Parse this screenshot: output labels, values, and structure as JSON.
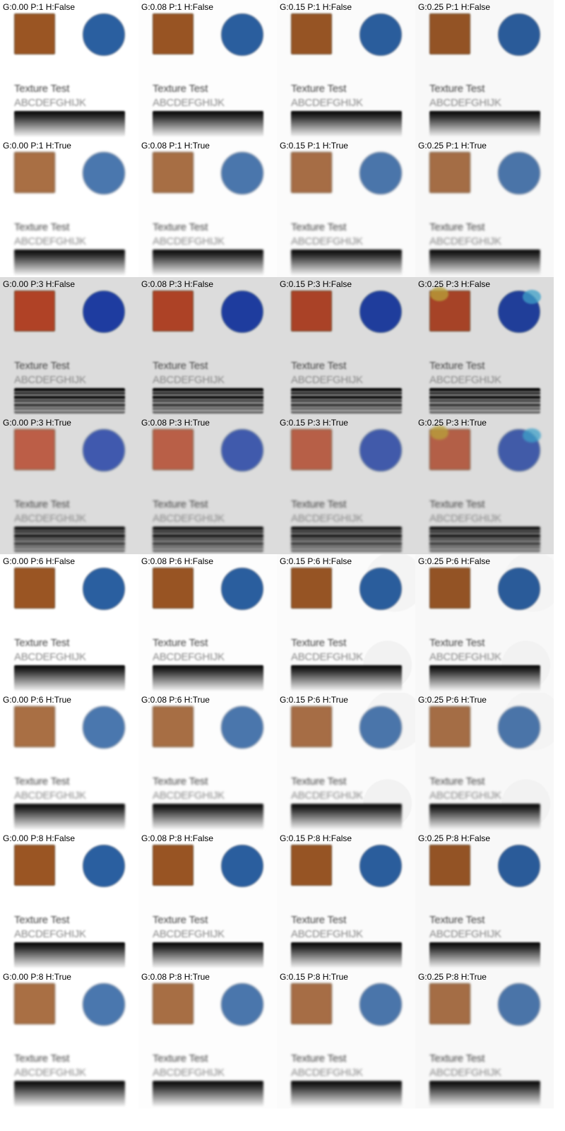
{
  "sample": {
    "title_text": "Texture Test",
    "alphabet_text": "ABCDEFGHIJK"
  },
  "colors": {
    "square_base": "#9a5523",
    "circle_base": "#2a5fa0"
  },
  "tiles": [
    {
      "label": "G:0.00 P:1 H:False",
      "g": 0.0,
      "p": 1,
      "h": false
    },
    {
      "label": "G:0.08 P:1 H:False",
      "g": 0.08,
      "p": 1,
      "h": false
    },
    {
      "label": "G:0.15 P:1 H:False",
      "g": 0.15,
      "p": 1,
      "h": false
    },
    {
      "label": "G:0.25 P:1 H:False",
      "g": 0.25,
      "p": 1,
      "h": false
    },
    {
      "label": "G:0.00 P:1 H:True",
      "g": 0.0,
      "p": 1,
      "h": true
    },
    {
      "label": "G:0.08 P:1 H:True",
      "g": 0.08,
      "p": 1,
      "h": true
    },
    {
      "label": "G:0.15 P:1 H:True",
      "g": 0.15,
      "p": 1,
      "h": true
    },
    {
      "label": "G:0.25 P:1 H:True",
      "g": 0.25,
      "p": 1,
      "h": true
    },
    {
      "label": "G:0.00 P:3 H:False",
      "g": 0.0,
      "p": 3,
      "h": false
    },
    {
      "label": "G:0.08 P:3 H:False",
      "g": 0.08,
      "p": 3,
      "h": false
    },
    {
      "label": "G:0.15 P:3 H:False",
      "g": 0.15,
      "p": 3,
      "h": false
    },
    {
      "label": "G:0.25 P:3 H:False",
      "g": 0.25,
      "p": 3,
      "h": false
    },
    {
      "label": "G:0.00 P:3 H:True",
      "g": 0.0,
      "p": 3,
      "h": true
    },
    {
      "label": "G:0.08 P:3 H:True",
      "g": 0.08,
      "p": 3,
      "h": true
    },
    {
      "label": "G:0.15 P:3 H:True",
      "g": 0.15,
      "p": 3,
      "h": true
    },
    {
      "label": "G:0.25 P:3 H:True",
      "g": 0.25,
      "p": 3,
      "h": true
    },
    {
      "label": "G:0.00 P:6 H:False",
      "g": 0.0,
      "p": 6,
      "h": false
    },
    {
      "label": "G:0.08 P:6 H:False",
      "g": 0.08,
      "p": 6,
      "h": false
    },
    {
      "label": "G:0.15 P:6 H:False",
      "g": 0.15,
      "p": 6,
      "h": false
    },
    {
      "label": "G:0.25 P:6 H:False",
      "g": 0.25,
      "p": 6,
      "h": false
    },
    {
      "label": "G:0.00 P:6 H:True",
      "g": 0.0,
      "p": 6,
      "h": true
    },
    {
      "label": "G:0.08 P:6 H:True",
      "g": 0.08,
      "p": 6,
      "h": true
    },
    {
      "label": "G:0.15 P:6 H:True",
      "g": 0.15,
      "p": 6,
      "h": true
    },
    {
      "label": "G:0.25 P:6 H:True",
      "g": 0.25,
      "p": 6,
      "h": true
    },
    {
      "label": "G:0.00 P:8 H:False",
      "g": 0.0,
      "p": 8,
      "h": false
    },
    {
      "label": "G:0.08 P:8 H:False",
      "g": 0.08,
      "p": 8,
      "h": false
    },
    {
      "label": "G:0.15 P:8 H:False",
      "g": 0.15,
      "p": 8,
      "h": false
    },
    {
      "label": "G:0.25 P:8 H:False",
      "g": 0.25,
      "p": 8,
      "h": false
    },
    {
      "label": "G:0.00 P:8 H:True",
      "g": 0.0,
      "p": 8,
      "h": true
    },
    {
      "label": "G:0.08 P:8 H:True",
      "g": 0.08,
      "p": 8,
      "h": true
    },
    {
      "label": "G:0.15 P:8 H:True",
      "g": 0.15,
      "p": 8,
      "h": true
    },
    {
      "label": "G:0.25 P:8 H:True",
      "g": 0.25,
      "p": 8,
      "h": true
    }
  ]
}
